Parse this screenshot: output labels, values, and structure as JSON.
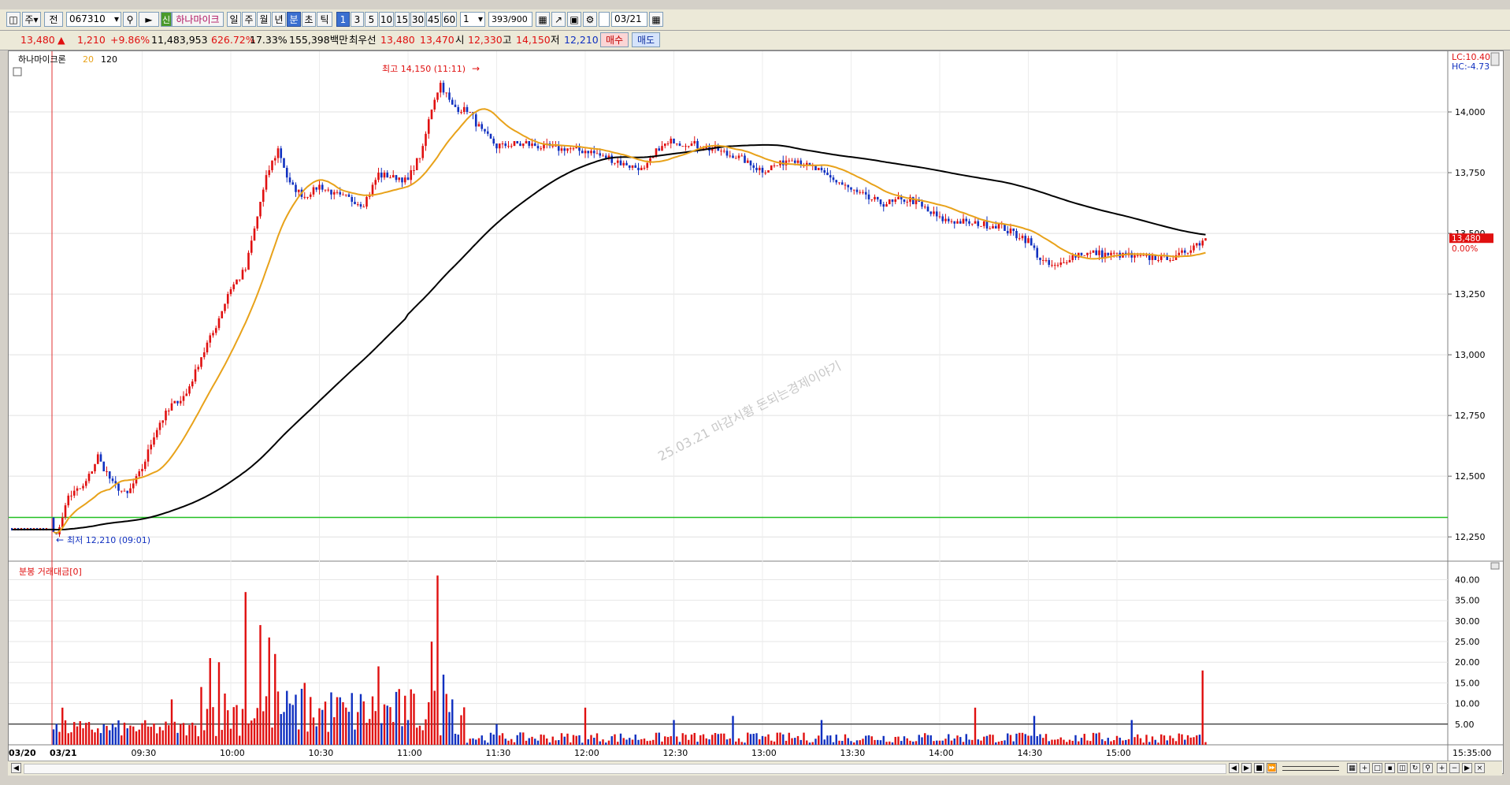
{
  "toolbar": {
    "mode_label": "주",
    "prev_label": "전",
    "stock_code": "067310",
    "stock_badge": "신",
    "stock_name": "하나마이크",
    "periods": [
      "일",
      "주",
      "월",
      "년",
      "분",
      "초",
      "틱"
    ],
    "active_period": "분",
    "intervals": [
      "1",
      "3",
      "5",
      "10",
      "15",
      "30",
      "45",
      "60"
    ],
    "active_interval": "1",
    "count_value": "1",
    "page_counter": "393/900",
    "date_value": "03/21"
  },
  "quote": {
    "price": "13,480",
    "change": "1,210",
    "change_pct": "+9.86%",
    "volume": "11,483,953",
    "volume_ratio": "626.72%",
    "turnover": "17.33%",
    "amount": "155,398백만",
    "best_label": "최우선",
    "best_ask": "13,480",
    "best_bid": "13,470",
    "open_label": "시",
    "open": "12,330",
    "high_label": "고",
    "high": "14,150",
    "low_label": "저",
    "low": "12,210",
    "buy_label": "매수",
    "sell_label": "매도"
  },
  "price_panel": {
    "legend_name": "하나마이크론",
    "ma_short": "20",
    "ma_long": "120",
    "lc_label": "LC:10.40",
    "hc_label": "HC:-4.73",
    "current_price_tag": "13,480",
    "current_pct_tag": "0.00%",
    "high_annotation": "최고 14,150 (11:11)",
    "low_annotation": "최저 12,210 (09:01)",
    "watermark": "25.03.21 마감시황 돈되는경제이야기",
    "colors": {
      "up": "#e01010",
      "down": "#1030c0",
      "ma_short": "#e8a21a",
      "ma_long": "#000000",
      "support": "#22c022"
    }
  },
  "volume_panel": {
    "legend": "분봉 거래대금[0]",
    "y_ticks": [
      "40.00",
      "35.00",
      "30.00",
      "25.00",
      "20.00",
      "15.00",
      "10.00",
      "5.00"
    ]
  },
  "xaxis": {
    "date_prev": "03/20",
    "date_curr": "03/21",
    "labels": [
      "09:30",
      "10:00",
      "10:30",
      "11:00",
      "11:30",
      "12:00",
      "12:30",
      "13:00",
      "13:30",
      "14:00",
      "14:30",
      "15:00"
    ],
    "end_label": "15:35:00"
  },
  "chart_data": {
    "type": "candlestick",
    "price_axis_ticks": [
      "14,000",
      "13,750",
      "13,500",
      "13,250",
      "13,000",
      "12,750",
      "12,500",
      "12,250"
    ],
    "ylim": [
      12150,
      14250
    ],
    "support_level": 12330,
    "open": 12330,
    "high": 14150,
    "low": 12210,
    "last": 13480,
    "close_path": [
      {
        "t": "09:00",
        "v": 12280
      },
      {
        "t": "09:01",
        "v": 12250
      },
      {
        "t": "09:05",
        "v": 12420
      },
      {
        "t": "09:10",
        "v": 12450
      },
      {
        "t": "09:15",
        "v": 12580
      },
      {
        "t": "09:20",
        "v": 12470
      },
      {
        "t": "09:25",
        "v": 12420
      },
      {
        "t": "09:30",
        "v": 12530
      },
      {
        "t": "09:35",
        "v": 12700
      },
      {
        "t": "09:40",
        "v": 12790
      },
      {
        "t": "09:45",
        "v": 12840
      },
      {
        "t": "09:50",
        "v": 12990
      },
      {
        "t": "09:55",
        "v": 13120
      },
      {
        "t": "10:00",
        "v": 13280
      },
      {
        "t": "10:05",
        "v": 13350
      },
      {
        "t": "10:08",
        "v": 13520
      },
      {
        "t": "10:12",
        "v": 13730
      },
      {
        "t": "10:16",
        "v": 13850
      },
      {
        "t": "10:20",
        "v": 13700
      },
      {
        "t": "10:25",
        "v": 13650
      },
      {
        "t": "10:30",
        "v": 13700
      },
      {
        "t": "10:35",
        "v": 13660
      },
      {
        "t": "10:40",
        "v": 13640
      },
      {
        "t": "10:45",
        "v": 13620
      },
      {
        "t": "10:50",
        "v": 13740
      },
      {
        "t": "10:55",
        "v": 13730
      },
      {
        "t": "11:00",
        "v": 13720
      },
      {
        "t": "11:05",
        "v": 13850
      },
      {
        "t": "11:08",
        "v": 14020
      },
      {
        "t": "11:11",
        "v": 14120
      },
      {
        "t": "11:15",
        "v": 14020
      },
      {
        "t": "11:20",
        "v": 14010
      },
      {
        "t": "11:25",
        "v": 13920
      },
      {
        "t": "11:30",
        "v": 13860
      },
      {
        "t": "11:40",
        "v": 13870
      },
      {
        "t": "11:50",
        "v": 13850
      },
      {
        "t": "12:00",
        "v": 13840
      },
      {
        "t": "12:10",
        "v": 13800
      },
      {
        "t": "12:20",
        "v": 13760
      },
      {
        "t": "12:25",
        "v": 13850
      },
      {
        "t": "12:30",
        "v": 13880
      },
      {
        "t": "12:40",
        "v": 13860
      },
      {
        "t": "12:50",
        "v": 13820
      },
      {
        "t": "13:00",
        "v": 13760
      },
      {
        "t": "13:10",
        "v": 13810
      },
      {
        "t": "13:20",
        "v": 13750
      },
      {
        "t": "13:30",
        "v": 13680
      },
      {
        "t": "13:40",
        "v": 13620
      },
      {
        "t": "13:50",
        "v": 13640
      },
      {
        "t": "14:00",
        "v": 13560
      },
      {
        "t": "14:10",
        "v": 13540
      },
      {
        "t": "14:20",
        "v": 13530
      },
      {
        "t": "14:30",
        "v": 13470
      },
      {
        "t": "14:35",
        "v": 13380
      },
      {
        "t": "14:40",
        "v": 13360
      },
      {
        "t": "14:45",
        "v": 13410
      },
      {
        "t": "14:50",
        "v": 13420
      },
      {
        "t": "15:00",
        "v": 13410
      },
      {
        "t": "15:10",
        "v": 13400
      },
      {
        "t": "15:20",
        "v": 13400
      },
      {
        "t": "15:30",
        "v": 13480
      }
    ],
    "volume_bars": [
      {
        "t": "09:03",
        "v": 9
      },
      {
        "t": "09:10",
        "v": 4
      },
      {
        "t": "09:25",
        "v": 4
      },
      {
        "t": "09:40",
        "v": 11
      },
      {
        "t": "09:50",
        "v": 14
      },
      {
        "t": "09:53",
        "v": 21
      },
      {
        "t": "09:56",
        "v": 20
      },
      {
        "t": "10:05",
        "v": 37
      },
      {
        "t": "10:10",
        "v": 29
      },
      {
        "t": "10:13",
        "v": 26
      },
      {
        "t": "10:15",
        "v": 22
      },
      {
        "t": "10:20",
        "v": 10
      },
      {
        "t": "10:25",
        "v": 15
      },
      {
        "t": "10:40",
        "v": 8
      },
      {
        "t": "10:50",
        "v": 19
      },
      {
        "t": "11:00",
        "v": 6
      },
      {
        "t": "11:08",
        "v": 25
      },
      {
        "t": "11:10",
        "v": 41
      },
      {
        "t": "11:12",
        "v": 17
      },
      {
        "t": "11:15",
        "v": 11
      },
      {
        "t": "11:30",
        "v": 5
      },
      {
        "t": "12:00",
        "v": 9
      },
      {
        "t": "12:30",
        "v": 6
      },
      {
        "t": "12:50",
        "v": 7
      },
      {
        "t": "13:20",
        "v": 6
      },
      {
        "t": "14:12",
        "v": 9
      },
      {
        "t": "14:32",
        "v": 7
      },
      {
        "t": "15:05",
        "v": 6
      },
      {
        "t": "15:29",
        "v": 18
      }
    ],
    "volume_ylim": [
      0,
      42
    ]
  }
}
